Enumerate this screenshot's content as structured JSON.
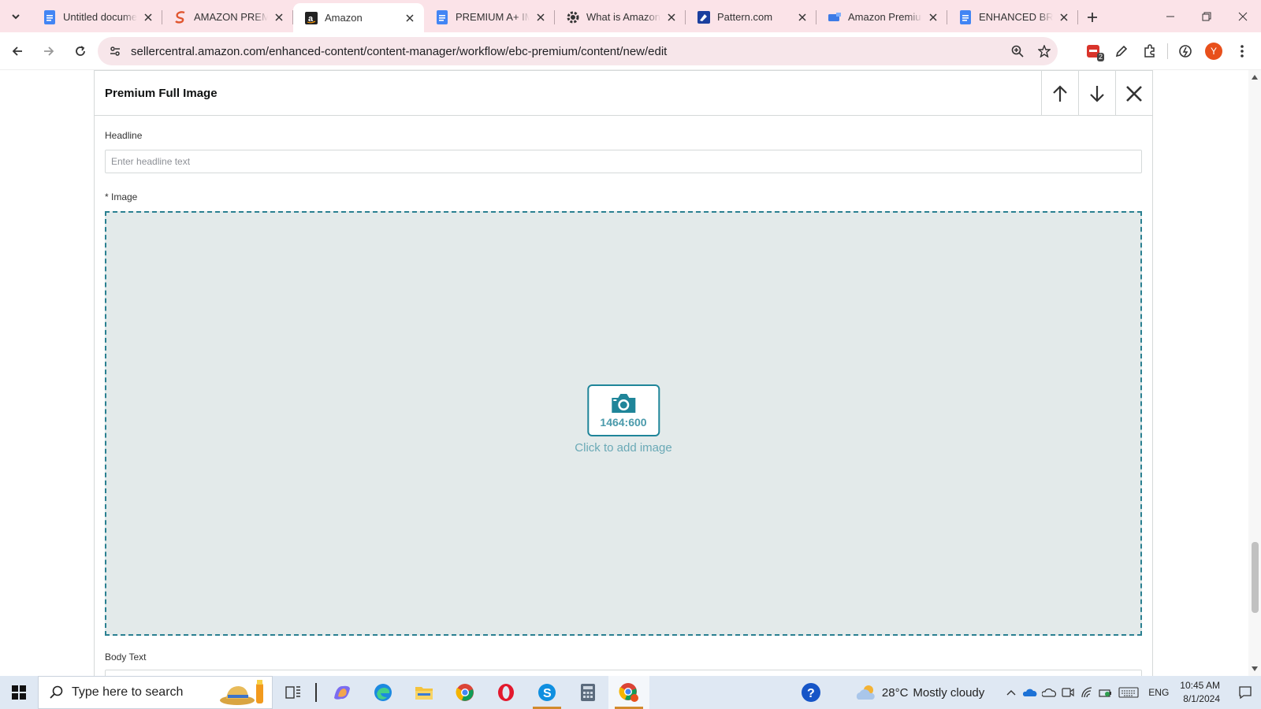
{
  "browser": {
    "tabs": [
      {
        "title": "Untitled docume",
        "icon": "google-docs-icon"
      },
      {
        "title": "AMAZON PREMI",
        "icon": "seller-app-icon"
      },
      {
        "title": "Amazon",
        "icon": "amazon-icon",
        "active": true
      },
      {
        "title": "PREMIUM A+ IM",
        "icon": "google-docs-icon"
      },
      {
        "title": "What is Amazon",
        "icon": "gear-site-icon"
      },
      {
        "title": "Pattern.com",
        "icon": "pattern-icon"
      },
      {
        "title": "Amazon Premiur",
        "icon": "site-icon"
      },
      {
        "title": "ENHANCED BRA",
        "icon": "google-docs-icon"
      }
    ],
    "url": "sellercentral.amazon.com/enhanced-content/content-manager/workflow/ebc-premium/content/new/edit",
    "extensions_badge": "2",
    "profile_initial": "Y"
  },
  "module": {
    "title": "Premium Full Image",
    "headline_label": "Headline",
    "headline_placeholder": "Enter headline text",
    "headline_value": "",
    "image_label": "* Image",
    "image_ratio": "1464:600",
    "image_cta": "Click to add image",
    "body_label": "Body Text"
  },
  "taskbar": {
    "search_placeholder": "Type here to search",
    "weather_temp": "28°C",
    "weather_text": "Mostly cloudy",
    "language": "ENG",
    "time": "10:45 AM",
    "date": "8/1/2024"
  },
  "colors": {
    "tabstrip_bg": "#fbe3e8",
    "dropzone_bg": "#e3eaea",
    "dropzone_border": "#2a8091",
    "accent_teal": "#1f8599"
  }
}
